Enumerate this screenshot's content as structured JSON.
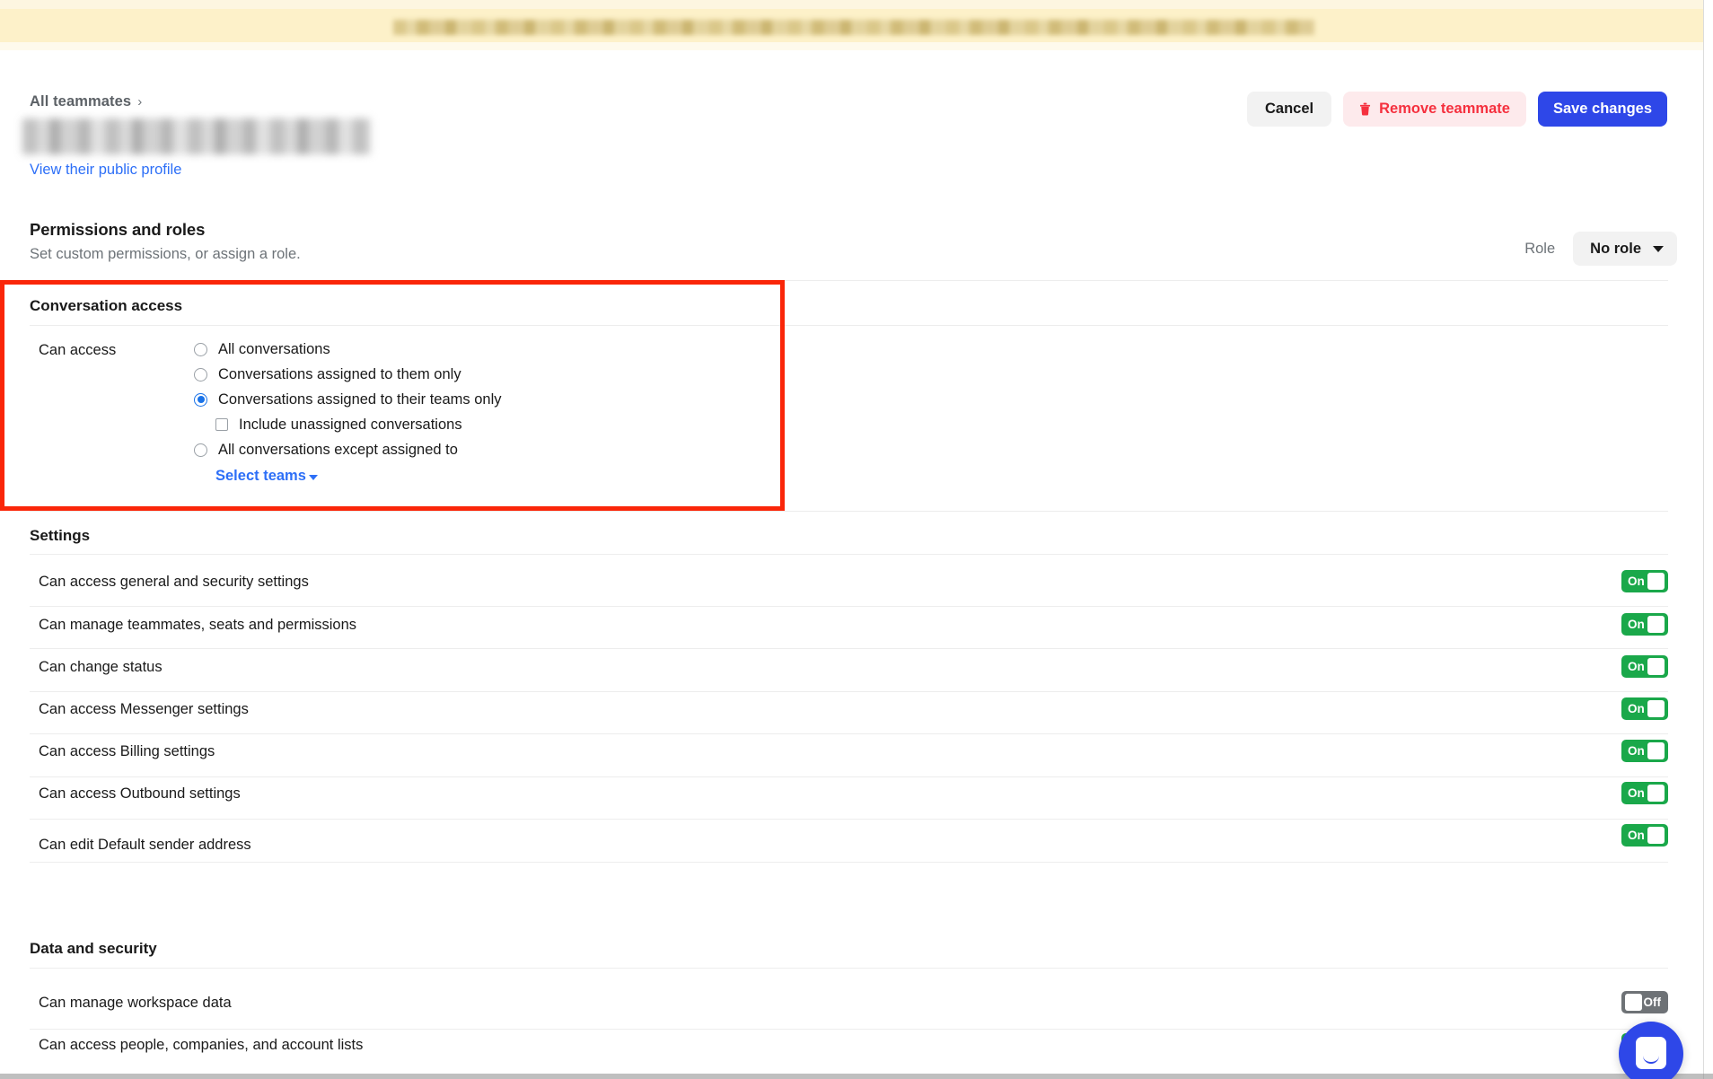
{
  "banner": {
    "redacted": true
  },
  "header": {
    "breadcrumb_label": "All teammates",
    "breadcrumb_chevron": "›",
    "teammate_name_redacted": true,
    "profile_link": "View their public profile",
    "cancel_label": "Cancel",
    "remove_label": "Remove teammate",
    "save_label": "Save changes"
  },
  "permissions": {
    "title": "Permissions and roles",
    "subtitle": "Set custom permissions, or assign a role.",
    "role_label": "Role",
    "role_value": "No role"
  },
  "conversation_access": {
    "section_title": "Conversation access",
    "row_label": "Can access",
    "options": [
      {
        "label": "All conversations",
        "type": "radio",
        "checked": false,
        "indent": false
      },
      {
        "label": "Conversations assigned to them only",
        "type": "radio",
        "checked": false,
        "indent": false
      },
      {
        "label": "Conversations assigned to their teams only",
        "type": "radio",
        "checked": true,
        "indent": false
      },
      {
        "label": "Include unassigned conversations",
        "type": "checkbox",
        "checked": false,
        "indent": true
      },
      {
        "label": "All conversations except assigned to",
        "type": "radio",
        "checked": false,
        "indent": false
      }
    ],
    "select_teams_label": "Select teams"
  },
  "settings": {
    "section_title": "Settings",
    "rows": [
      {
        "label": "Can access general and security settings",
        "state": "On"
      },
      {
        "label": "Can manage teammates, seats and permissions",
        "state": "On"
      },
      {
        "label": "Can change status",
        "state": "On"
      },
      {
        "label": "Can access Messenger settings",
        "state": "On"
      },
      {
        "label": "Can access Billing settings",
        "state": "On"
      },
      {
        "label": "Can access Outbound settings",
        "state": "On"
      },
      {
        "label": "Can edit Default sender address",
        "state": "On"
      }
    ]
  },
  "data_and_security": {
    "section_title": "Data and security",
    "rows": [
      {
        "label": "Can manage workspace data",
        "state": "Off"
      },
      {
        "label": "Can access people, companies, and account lists",
        "state": "On"
      }
    ]
  },
  "widgets": {
    "intercom_launcher": "intercom-messenger-icon"
  },
  "colors": {
    "banner": "#fdf1c9",
    "accent_blue": "#2e47e8",
    "link_blue": "#2d6ff7",
    "radio_blue": "#1a73e8",
    "danger_red": "#f5303e",
    "toggle_on_green": "#1aa84a",
    "toggle_off_gray": "#6e7276",
    "highlight_box_red": "#fa2609"
  }
}
